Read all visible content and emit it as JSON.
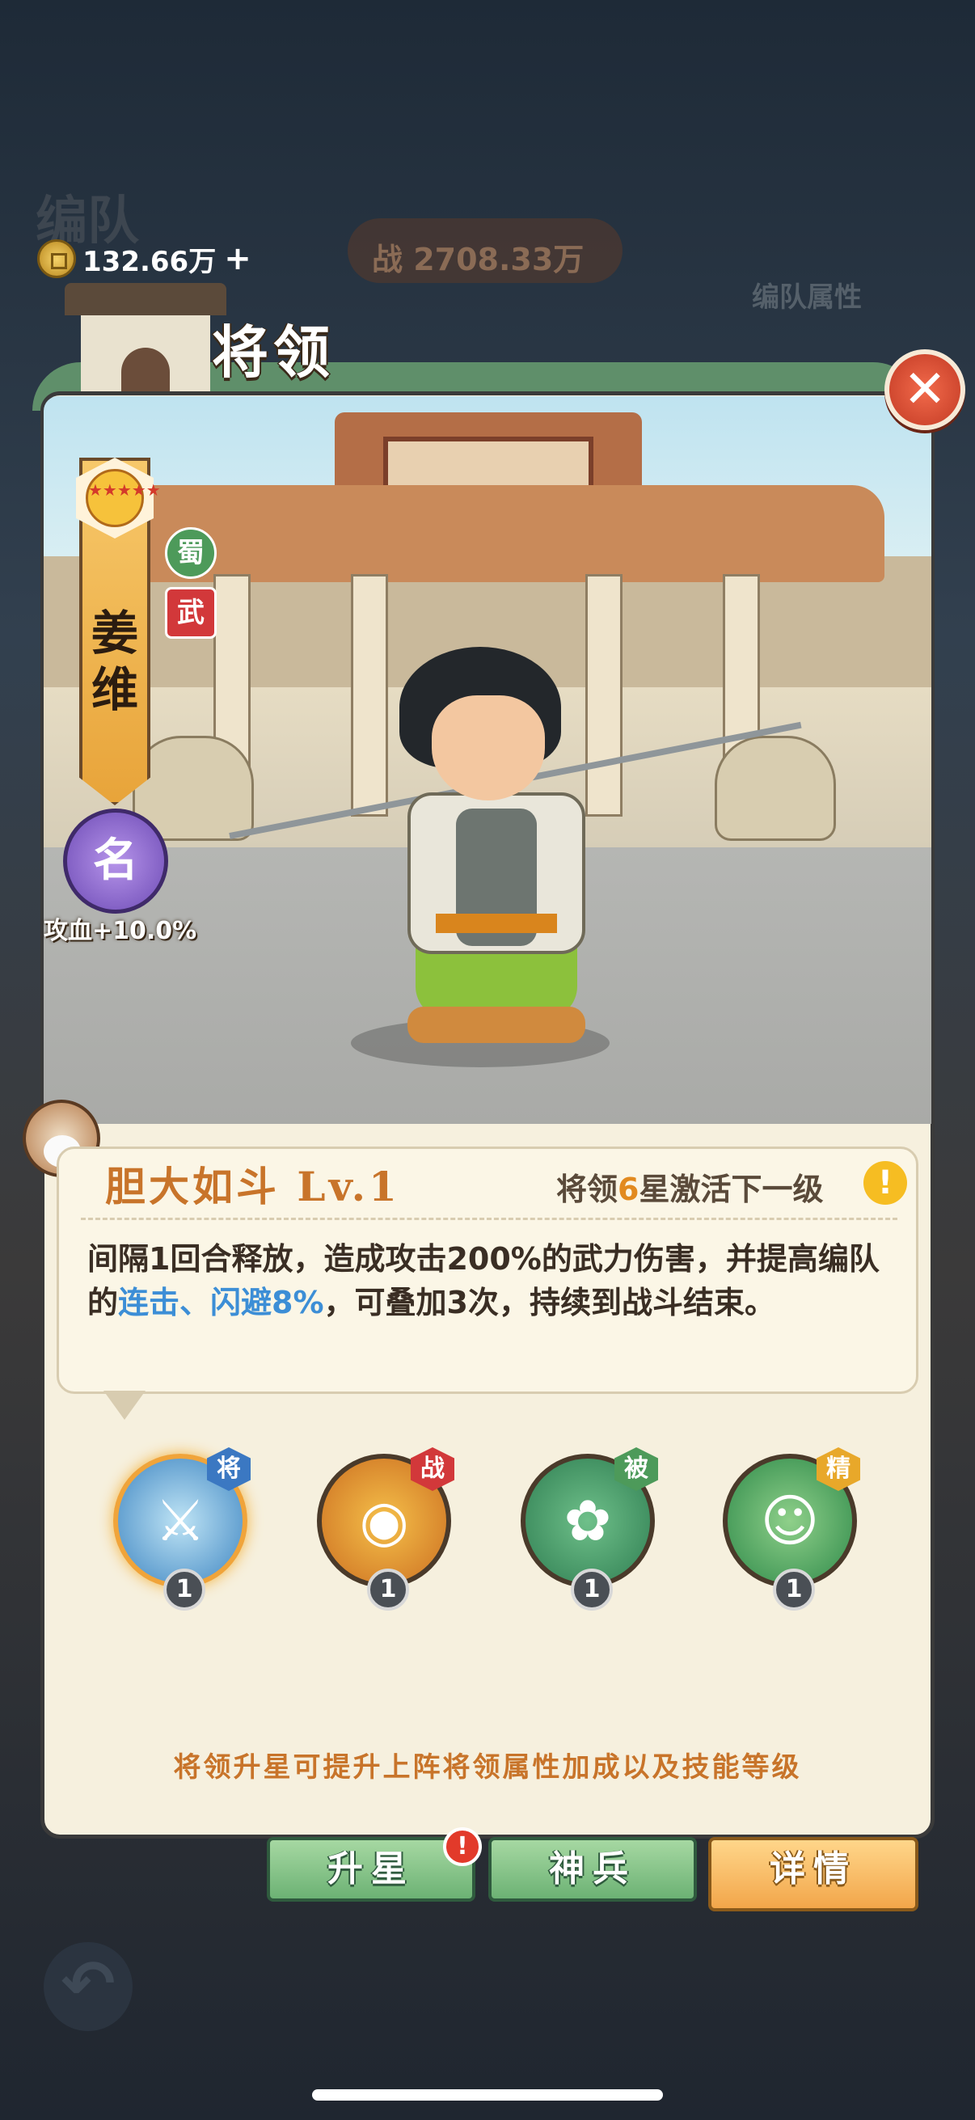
{
  "background": {
    "title": "编队",
    "coins": "132.66万",
    "coin_plus": "+",
    "power": "战 2708.33万",
    "right_badge": "编队属性"
  },
  "header": {
    "title": "将领",
    "close_glyph": "✕"
  },
  "hero": {
    "name": "姜维",
    "stars": "★★★★★",
    "factions": [
      "蜀",
      "武"
    ],
    "fame_label": "名",
    "fame_bonus": "攻血+10.0%"
  },
  "skill": {
    "name": "胆大如斗 Lv.1",
    "hint_prefix": "将领",
    "hint_star": "6",
    "hint_suffix": "星激活下一级",
    "warn_glyph": "!",
    "desc_part1": "间隔1回合释放，造成攻击200%的武力伤害，并提高编队的",
    "desc_highlight": "连击、闪避8%",
    "desc_part2": "，可叠加3次，持续到战斗结束。"
  },
  "skill_icons": [
    {
      "tag": "将",
      "level": "1",
      "glyph": "⚔",
      "icon": "spear-icon"
    },
    {
      "tag": "战",
      "level": "1",
      "glyph": "◉",
      "icon": "drum-icon"
    },
    {
      "tag": "被",
      "level": "1",
      "glyph": "✿",
      "icon": "fan-icon"
    },
    {
      "tag": "精",
      "level": "1",
      "glyph": "☺",
      "icon": "cheer-icon"
    }
  ],
  "footer_tip": "将领升星可提升上阵将领属性加成以及技能等级",
  "tabs": [
    {
      "label": "升星"
    },
    {
      "label": "神兵"
    },
    {
      "label": "详情"
    }
  ],
  "red_dot": "!",
  "back_glyph": "↶"
}
